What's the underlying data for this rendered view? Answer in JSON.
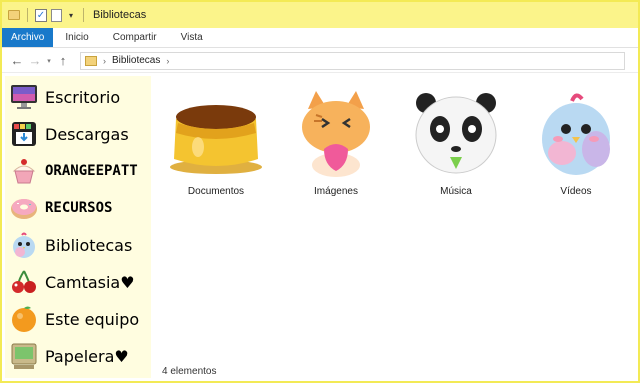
{
  "window": {
    "title": "Bibliotecas"
  },
  "ribbon": {
    "tabs": [
      "Archivo",
      "Inicio",
      "Compartir",
      "Vista"
    ]
  },
  "address": {
    "path": [
      "Bibliotecas"
    ]
  },
  "sidebar": {
    "items": [
      {
        "label": "Escritorio",
        "icon": "monitor-icon"
      },
      {
        "label": "Descargas",
        "icon": "download-box-icon"
      },
      {
        "label": "ORANGEEPATT",
        "icon": "cupcake-icon"
      },
      {
        "label": "RECURSOS",
        "icon": "donut-icon"
      },
      {
        "label": "Bibliotecas",
        "icon": "bird-icon"
      },
      {
        "label": "Camtasia♥",
        "icon": "cherries-icon"
      },
      {
        "label": "Este equipo",
        "icon": "orange-icon"
      },
      {
        "label": "Papelera♥",
        "icon": "retro-computer-icon"
      }
    ]
  },
  "libraries": [
    {
      "label": "Documentos",
      "icon": "flan-icon"
    },
    {
      "label": "Imágenes",
      "icon": "cat-icon"
    },
    {
      "label": "Música",
      "icon": "panda-icon"
    },
    {
      "label": "Vídeos",
      "icon": "bird-icon"
    }
  ],
  "status": {
    "count": "4 elementos"
  },
  "colors": {
    "accent": "#1979ca",
    "titlebar": "#fbf48a",
    "sidebar": "#fffde0"
  }
}
